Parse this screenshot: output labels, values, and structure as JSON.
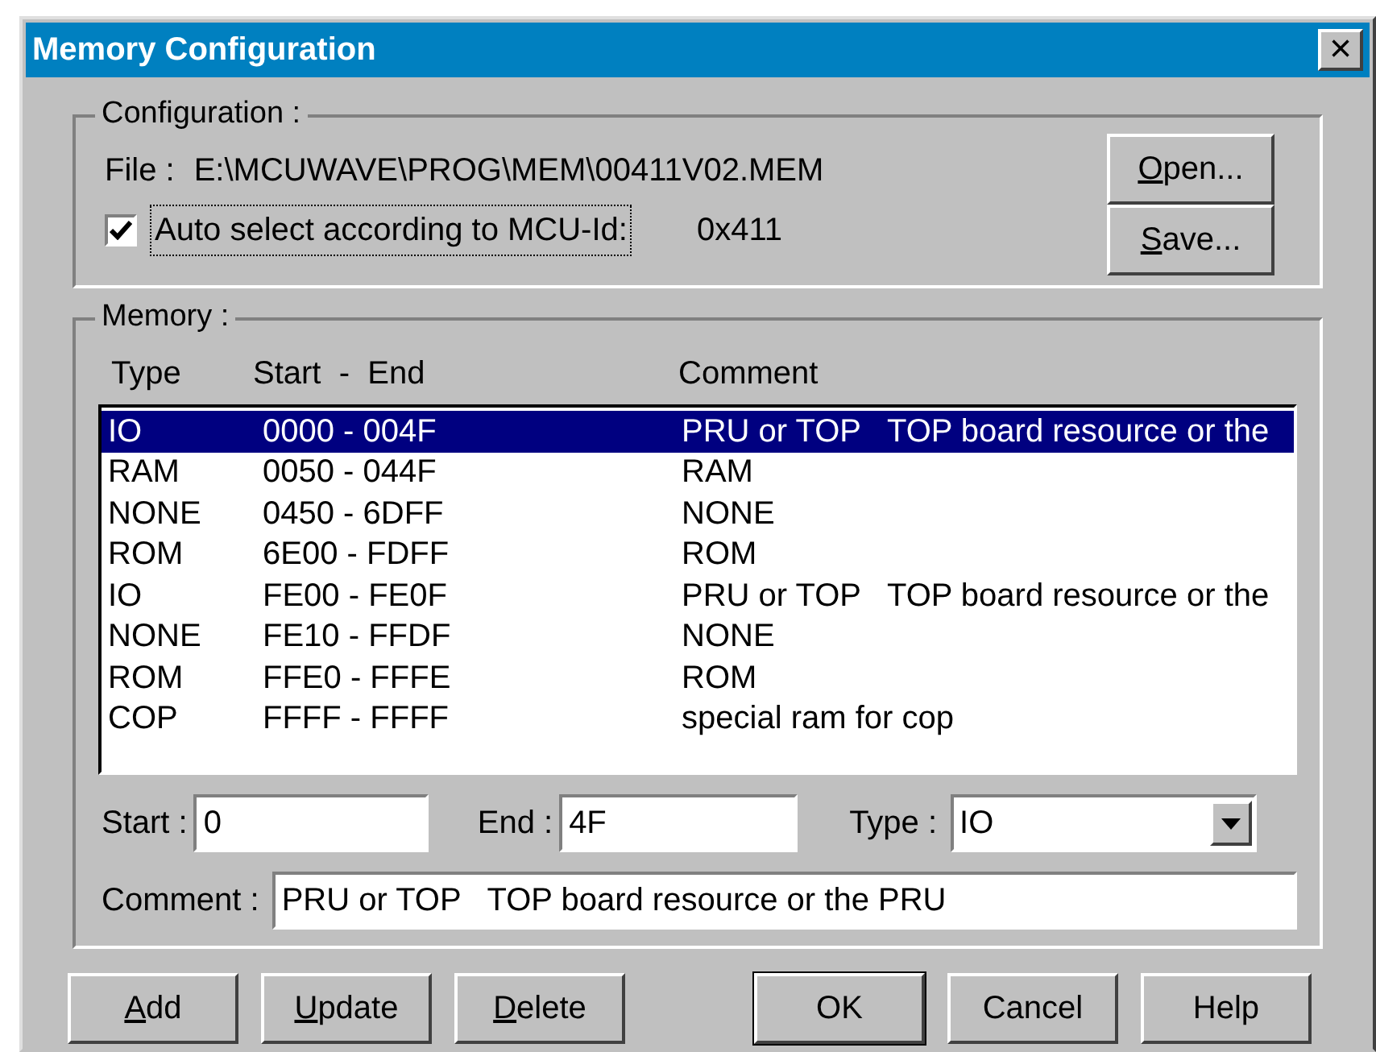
{
  "window": {
    "title": "Memory Configuration",
    "close": "×"
  },
  "configuration": {
    "legend": "Configuration :",
    "file_label": "File :",
    "file_path": "E:\\MCUWAVE\\PROG\\MEM\\00411V02.MEM",
    "auto_select": {
      "label": "Auto select according to MCU-Id:",
      "checked": true
    },
    "mcu_id": "0x411",
    "buttons": [
      {
        "label": "Open...",
        "underline_first": true
      },
      {
        "label": "Save...",
        "underline_first": true
      }
    ]
  },
  "memory": {
    "legend": "Memory :",
    "columns": [
      "Type",
      "Start  -  End",
      "Comment"
    ],
    "rows": [
      {
        "type": "IO",
        "range": "0000 - 004F",
        "comment": "PRU or TOP   TOP board resource or the",
        "selected": true
      },
      {
        "type": "RAM",
        "range": "0050 - 044F",
        "comment": "RAM",
        "selected": false
      },
      {
        "type": "NONE",
        "range": "0450 - 6DFF",
        "comment": "NONE",
        "selected": false
      },
      {
        "type": "ROM",
        "range": "6E00 - FDFF",
        "comment": "ROM",
        "selected": false
      },
      {
        "type": "IO",
        "range": "FE00 - FE0F",
        "comment": "PRU or TOP   TOP board resource or the",
        "selected": false
      },
      {
        "type": "NONE",
        "range": "FE10 - FFDF",
        "comment": "NONE",
        "selected": false
      },
      {
        "type": "ROM",
        "range": "FFE0 - FFFE",
        "comment": "ROM",
        "selected": false
      },
      {
        "type": "COP",
        "range": "FFFF - FFFF",
        "comment": "special ram for cop",
        "selected": false
      }
    ],
    "start": {
      "label": "Start :",
      "value": "0"
    },
    "end": {
      "label": "End :",
      "value": "4F"
    },
    "type": {
      "label": "Type :",
      "value": "IO"
    },
    "comment": {
      "label": "Comment :",
      "value": "PRU or TOP   TOP board resource or the PRU"
    }
  },
  "buttons": [
    {
      "label": "Add",
      "underline_first": true,
      "default": false
    },
    {
      "label": "Update",
      "underline_first": true,
      "default": false
    },
    {
      "label": "Delete",
      "underline_first": true,
      "default": false
    },
    {
      "label": "OK",
      "underline_first": false,
      "default": true
    },
    {
      "label": "Cancel",
      "underline_first": false,
      "default": false
    },
    {
      "label": "Help",
      "underline_first": false,
      "default": false
    }
  ]
}
